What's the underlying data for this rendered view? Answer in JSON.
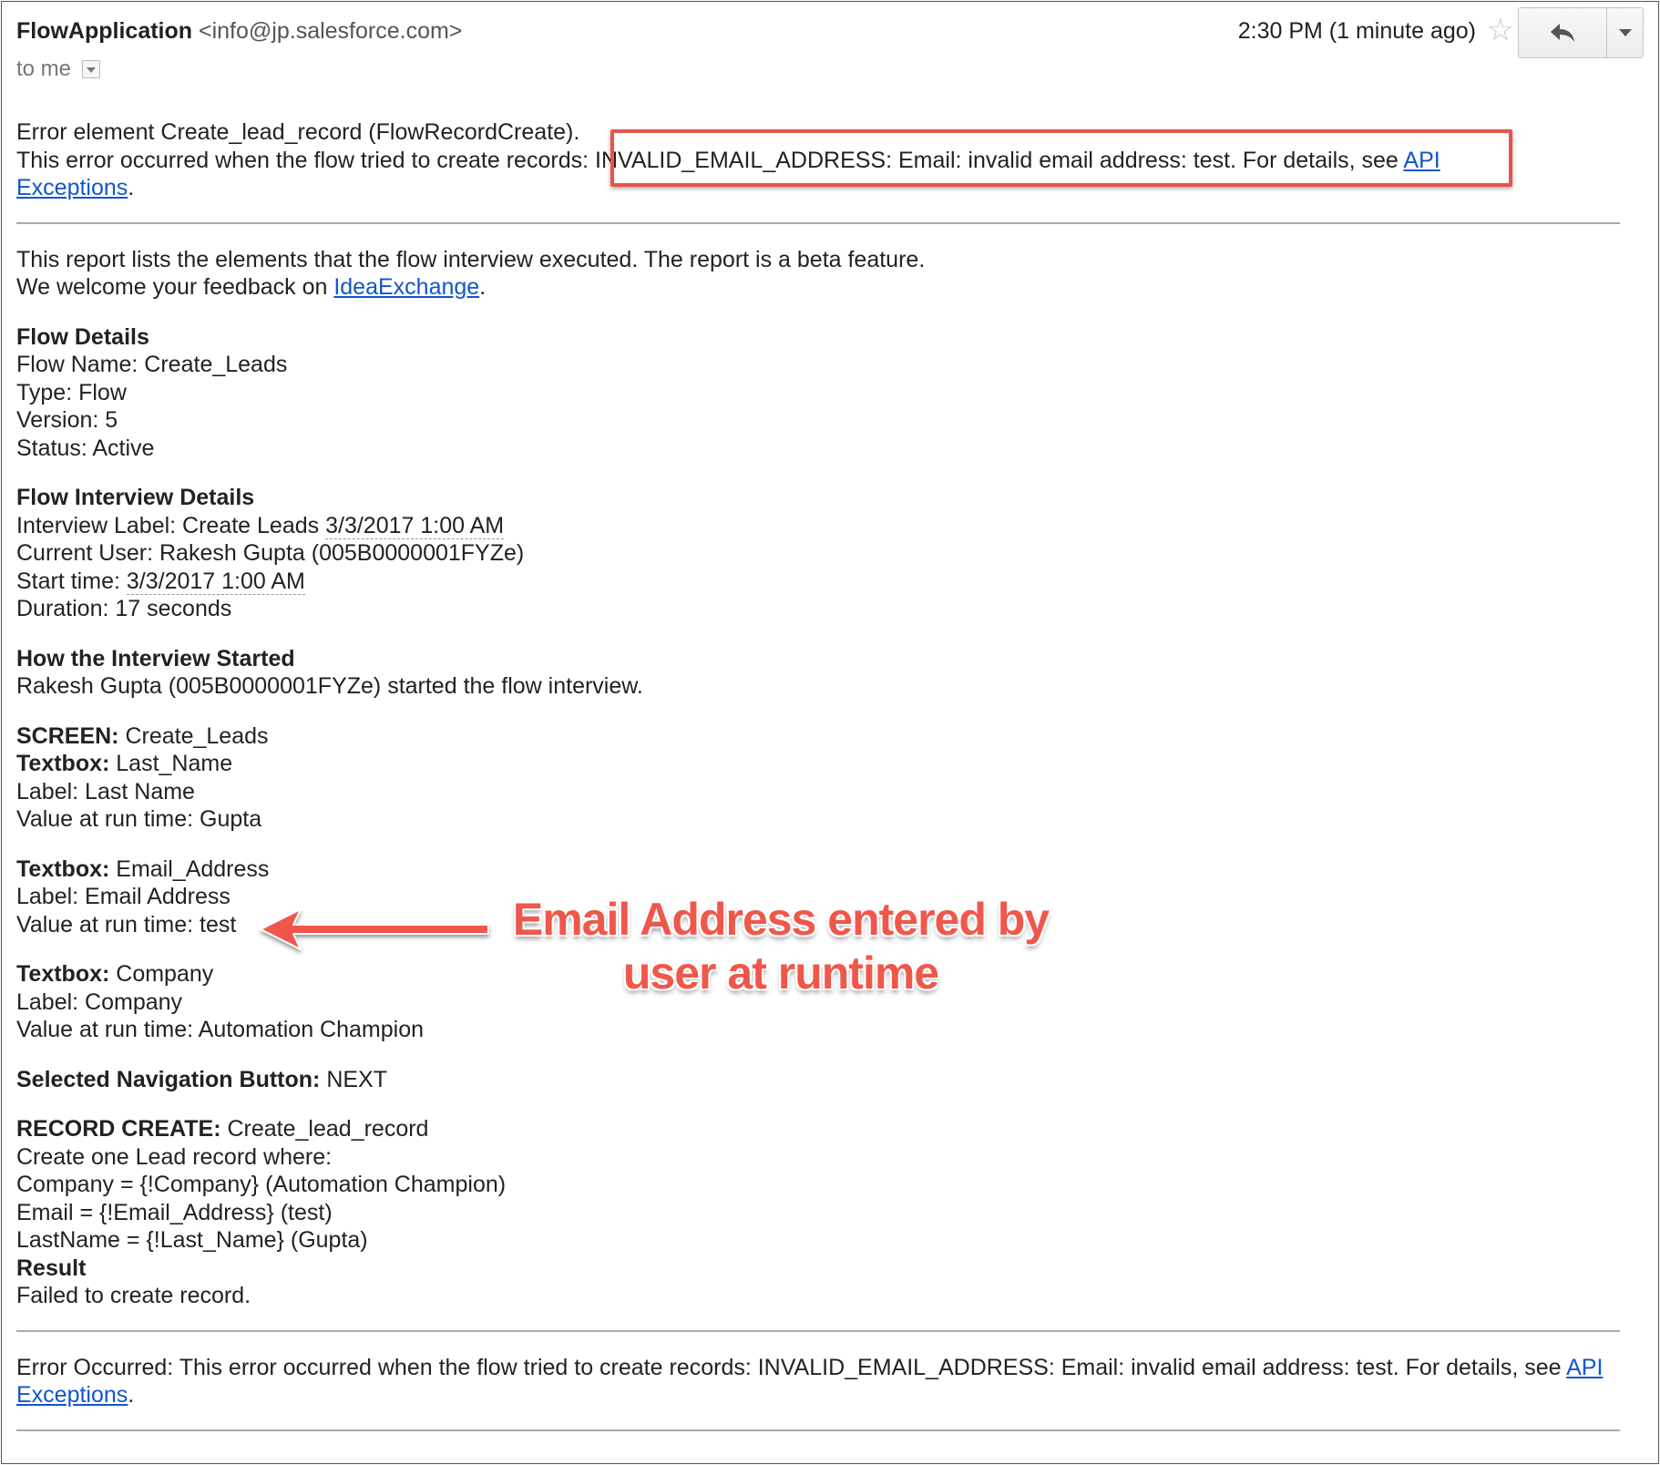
{
  "header": {
    "sender_name": "FlowApplication",
    "sender_email": "<info@jp.salesforce.com>",
    "to_label": "to me",
    "time": "2:30 PM (1 minute ago)"
  },
  "icons": {
    "star": "star-icon",
    "reply": "reply-icon",
    "more": "chevron-down-icon",
    "to_dropdown": "chevron-down-icon"
  },
  "error": {
    "line1": "Error element Create_lead_record (FlowRecordCreate).",
    "line2_prefix": "This error occurred when the flow tried to create records: ",
    "line2_highlight": "INVALID_EMAIL_ADDRESS: Email: invalid email address: test. For details, see ",
    "link_part1": "API",
    "link_part2": "Exceptions",
    "suffix": "."
  },
  "intro": {
    "line1": "This report lists the elements that the flow interview executed. The report is a beta feature.",
    "line2_prefix": "We welcome your feedback on ",
    "link": "IdeaExchange",
    "suffix": "."
  },
  "flow_details": {
    "heading": "Flow Details",
    "name": "Flow Name: Create_Leads",
    "type": "Type: Flow",
    "version": "Version: 5",
    "status": "Status: Active"
  },
  "interview_details": {
    "heading": "Flow Interview Details",
    "label_prefix": "Interview Label: Create Leads ",
    "label_date": "3/3/2017 1:00 AM",
    "current_user": "Current User: Rakesh Gupta (005B0000001FYZe)",
    "start_prefix": "Start time: ",
    "start_date": "3/3/2017 1:00 AM",
    "duration": "Duration: 17 seconds"
  },
  "how_started": {
    "heading": "How the Interview Started",
    "text": "Rakesh Gupta (005B0000001FYZe) started the flow interview."
  },
  "screen": {
    "label": "SCREEN:",
    "value": " Create_Leads",
    "textbox1_label": "Textbox:",
    "textbox1_value": " Last_Name",
    "textbox1_field": "Label: Last Name",
    "textbox1_runtime": "Value at run time: Gupta",
    "textbox2_label": "Textbox:",
    "textbox2_value": " Email_Address",
    "textbox2_field": "Label: Email Address",
    "textbox2_runtime": "Value at run time: test",
    "textbox3_label": "Textbox:",
    "textbox3_value": " Company",
    "textbox3_field": "Label: Company",
    "textbox3_runtime": "Value at run time: Automation Champion",
    "nav_label": "Selected Navigation Button:",
    "nav_value": " NEXT"
  },
  "record_create": {
    "label": "RECORD CREATE:",
    "value": " Create_lead_record",
    "line1": "Create one Lead record where:",
    "line2": "Company = {!Company} (Automation Champion)",
    "line3": "Email = {!Email_Address} (test)",
    "line4": "LastName = {!Last_Name} (Gupta)",
    "result_label": "Result",
    "result_text": "Failed to create record."
  },
  "footer": {
    "text": "Error Occurred: This error occurred when the flow tried to create records: INVALID_EMAIL_ADDRESS: Email: invalid email address: test. For details, see ",
    "link": "API Exceptions",
    "suffix": "."
  },
  "annotation": {
    "line1": "Email Address entered by",
    "line2": "user at runtime",
    "color": "#f0574b"
  },
  "colors": {
    "link": "#1155cc",
    "highlight_border": "#e8534a"
  }
}
